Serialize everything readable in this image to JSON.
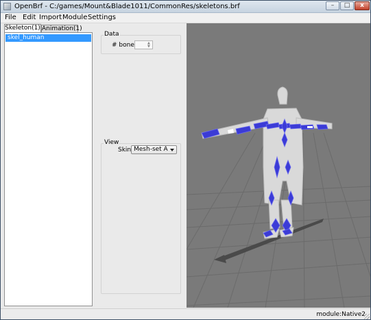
{
  "window": {
    "title": "OpenBrf - C:/games/Mount&Blade1011/CommonRes/skeletons.brf",
    "controls": {
      "minimize": "–",
      "maximize": "□",
      "close": "x"
    }
  },
  "menu": {
    "items": [
      "File",
      "Edit",
      "Import",
      "Module",
      "Settings"
    ]
  },
  "left_panel": {
    "tabs": [
      {
        "label": "Skeleton(1)",
        "active": true
      },
      {
        "label": "Animation(1)",
        "active": false
      }
    ],
    "list": {
      "items": [
        "skel_human"
      ],
      "selected_index": 0
    }
  },
  "data_group": {
    "title": "Data",
    "bones_label": "# bones:",
    "bones_value": ""
  },
  "view_group": {
    "title": "View",
    "skin_label": "Skin:",
    "skin_value": "Mesh-set A"
  },
  "viewport": {
    "description_icon": "3d-skeleton-viewport",
    "background_color": "#7a7a7a",
    "bone_color": "#3b3bd6"
  },
  "status": {
    "text": "module:Native2"
  }
}
